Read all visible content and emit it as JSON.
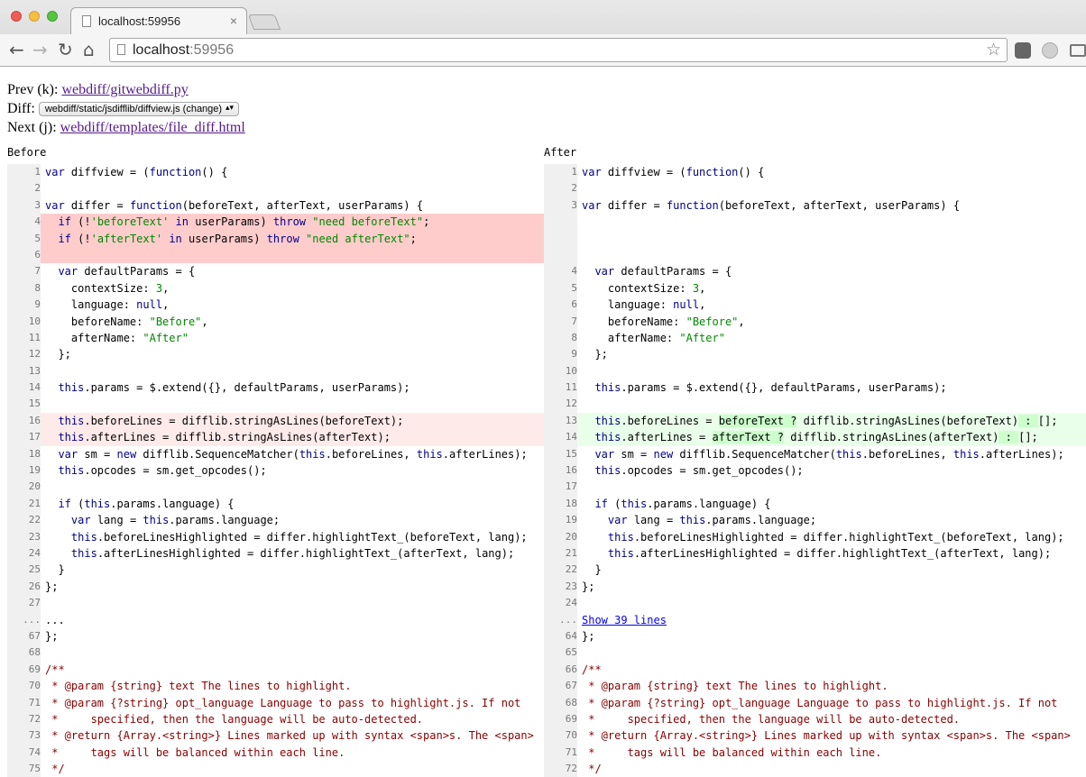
{
  "browser": {
    "tab_title": "localhost:59956",
    "tab_close": "×",
    "url_host": "localhost",
    "url_port": ":59956",
    "back": "←",
    "forward": "→",
    "reload": "↻",
    "home": "⌂",
    "star": "☆"
  },
  "nav": {
    "prev_label": "Prev (k): ",
    "prev_link": "webdiff/gitwebdiff.py",
    "diff_label": "Diff: ",
    "diff_select": "webdiff/static/jsdifflib/diffview.js (change)",
    "next_label": "Next (j): ",
    "next_link": "webdiff/templates/file_diff.html"
  },
  "before_title": "Before",
  "after_title": "After",
  "rows": [
    {
      "l": "1",
      "lc": "var diffview = (function() {",
      "r": "1",
      "rc": "var diffview = (function() {"
    },
    {
      "l": "2",
      "lc": "",
      "r": "2",
      "rc": ""
    },
    {
      "l": "3",
      "lc": "var differ = function(beforeText, afterText, userParams) {",
      "r": "3",
      "rc": "var differ = function(beforeText, afterText, userParams) {"
    },
    {
      "l": "4",
      "lc": "  if (!'beforeText' in userParams) throw \"need beforeText\";",
      "r": "",
      "rc": "",
      "type": "del"
    },
    {
      "l": "5",
      "lc": "  if (!'afterText' in userParams) throw \"need afterText\";",
      "r": "",
      "rc": "",
      "type": "del"
    },
    {
      "l": "6",
      "lc": "",
      "r": "",
      "rc": "",
      "type": "del"
    },
    {
      "l": "7",
      "lc": "  var defaultParams = {",
      "r": "4",
      "rc": "  var defaultParams = {"
    },
    {
      "l": "8",
      "lc": "    contextSize: 3,",
      "r": "5",
      "rc": "    contextSize: 3,"
    },
    {
      "l": "9",
      "lc": "    language: null,",
      "r": "6",
      "rc": "    language: null,"
    },
    {
      "l": "10",
      "lc": "    beforeName: \"Before\",",
      "r": "7",
      "rc": "    beforeName: \"Before\","
    },
    {
      "l": "11",
      "lc": "    afterName: \"After\"",
      "r": "8",
      "rc": "    afterName: \"After\""
    },
    {
      "l": "12",
      "lc": "  };",
      "r": "9",
      "rc": "  };"
    },
    {
      "l": "13",
      "lc": "",
      "r": "10",
      "rc": ""
    },
    {
      "l": "14",
      "lc": "  this.params = $.extend({}, defaultParams, userParams);",
      "r": "11",
      "rc": "  this.params = $.extend({}, defaultParams, userParams);"
    },
    {
      "l": "15",
      "lc": "",
      "r": "12",
      "rc": ""
    },
    {
      "l": "16",
      "lc": "  this.beforeLines = difflib.stringAsLines(beforeText);",
      "r": "13",
      "rc": "  this.beforeLines = beforeText ? difflib.stringAsLines(beforeText) : [];",
      "type": "chg"
    },
    {
      "l": "17",
      "lc": "  this.afterLines = difflib.stringAsLines(afterText);",
      "r": "14",
      "rc": "  this.afterLines = afterText ? difflib.stringAsLines(afterText) : [];",
      "type": "chg"
    },
    {
      "l": "18",
      "lc": "  var sm = new difflib.SequenceMatcher(this.beforeLines, this.afterLines);",
      "r": "15",
      "rc": "  var sm = new difflib.SequenceMatcher(this.beforeLines, this.afterLines);"
    },
    {
      "l": "19",
      "lc": "  this.opcodes = sm.get_opcodes();",
      "r": "16",
      "rc": "  this.opcodes = sm.get_opcodes();"
    },
    {
      "l": "20",
      "lc": "",
      "r": "17",
      "rc": ""
    },
    {
      "l": "21",
      "lc": "  if (this.params.language) {",
      "r": "18",
      "rc": "  if (this.params.language) {"
    },
    {
      "l": "22",
      "lc": "    var lang = this.params.language;",
      "r": "19",
      "rc": "    var lang = this.params.language;"
    },
    {
      "l": "23",
      "lc": "    this.beforeLinesHighlighted = differ.highlightText_(beforeText, lang);",
      "r": "20",
      "rc": "    this.beforeLinesHighlighted = differ.highlightText_(beforeText, lang);"
    },
    {
      "l": "24",
      "lc": "    this.afterLinesHighlighted = differ.highlightText_(afterText, lang);",
      "r": "21",
      "rc": "    this.afterLinesHighlighted = differ.highlightText_(afterText, lang);"
    },
    {
      "l": "25",
      "lc": "  }",
      "r": "22",
      "rc": "  }"
    },
    {
      "l": "26",
      "lc": "};",
      "r": "23",
      "rc": "};"
    },
    {
      "l": "27",
      "lc": "",
      "r": "24",
      "rc": ""
    },
    {
      "l": "...",
      "lc": "...",
      "r": "...",
      "rc": "Show 39 lines",
      "type": "skip"
    },
    {
      "l": "67",
      "lc": "};",
      "r": "64",
      "rc": "};"
    },
    {
      "l": "68",
      "lc": "",
      "r": "65",
      "rc": ""
    },
    {
      "l": "69",
      "lc": "/**",
      "r": "66",
      "rc": "/**",
      "type": "cmt"
    },
    {
      "l": "70",
      "lc": " * @param {string} text The lines to highlight.",
      "r": "67",
      "rc": " * @param {string} text The lines to highlight.",
      "type": "cmt"
    },
    {
      "l": "71",
      "lc": " * @param {?string} opt_language Language to pass to highlight.js. If not",
      "r": "68",
      "rc": " * @param {?string} opt_language Language to pass to highlight.js. If not",
      "type": "cmt"
    },
    {
      "l": "72",
      "lc": " *     specified, then the language will be auto-detected.",
      "r": "69",
      "rc": " *     specified, then the language will be auto-detected.",
      "type": "cmt"
    },
    {
      "l": "73",
      "lc": " * @return {Array.<string>} Lines marked up with syntax <span>s. The <span>",
      "r": "70",
      "rc": " * @return {Array.<string>} Lines marked up with syntax <span>s. The <span>",
      "type": "cmt"
    },
    {
      "l": "74",
      "lc": " *     tags will be balanced within each line.",
      "r": "71",
      "rc": " *     tags will be balanced within each line.",
      "type": "cmt"
    },
    {
      "l": "75",
      "lc": " */",
      "r": "72",
      "rc": " */",
      "type": "cmt"
    }
  ]
}
